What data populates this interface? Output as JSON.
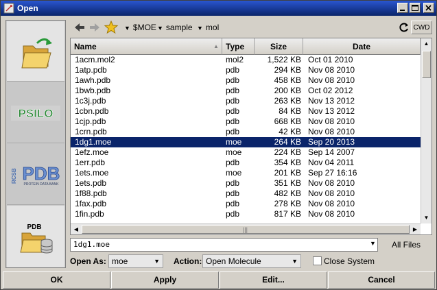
{
  "window": {
    "title": "Open"
  },
  "sidebar": {
    "items": [
      {
        "name": "open-folder"
      },
      {
        "name": "psilo",
        "label": "PSILO"
      },
      {
        "name": "rcsb-pdb",
        "label": "PDB",
        "sublabel": "PROTEIN DATA BANK",
        "prefix": "RCSB"
      },
      {
        "name": "pdb-folder",
        "label": "PDB"
      }
    ]
  },
  "toolbar": {
    "path": [
      "$MOE",
      "sample",
      "mol"
    ],
    "cwd_label": "CWD"
  },
  "table": {
    "columns": [
      "Name",
      "Type",
      "Size",
      "Date"
    ],
    "rows": [
      {
        "name": "1acm.mol2",
        "type": "mol2",
        "size": "1,522 KB",
        "date": " Oct 01 2010"
      },
      {
        "name": "1atp.pdb",
        "type": "pdb",
        "size": "294 KB",
        "date": "Nov 08 2010"
      },
      {
        "name": "1awh.pdb",
        "type": "pdb",
        "size": "458 KB",
        "date": "Nov 08 2010"
      },
      {
        "name": "1bwb.pdb",
        "type": "pdb",
        "size": "200 KB",
        "date": " Oct 02 2012"
      },
      {
        "name": "1c3j.pdb",
        "type": "pdb",
        "size": "263 KB",
        "date": "Nov 13 2012"
      },
      {
        "name": "1cbn.pdb",
        "type": "pdb",
        "size": "84 KB",
        "date": "Nov 13 2012"
      },
      {
        "name": "1cjp.pdb",
        "type": "pdb",
        "size": "668 KB",
        "date": "Nov 08 2010"
      },
      {
        "name": "1crn.pdb",
        "type": "pdb",
        "size": "42 KB",
        "date": "Nov 08 2010"
      },
      {
        "name": "1dg1.moe",
        "type": "moe",
        "size": "264 KB",
        "date": "Sep 20 2013",
        "selected": true
      },
      {
        "name": "1efz.moe",
        "type": "moe",
        "size": "224 KB",
        "date": "Sep 14 2007"
      },
      {
        "name": "1err.pdb",
        "type": "pdb",
        "size": "354 KB",
        "date": "Nov 04 2011"
      },
      {
        "name": "1ets.moe",
        "type": "moe",
        "size": "201 KB",
        "date": "Sep 27 16:16"
      },
      {
        "name": "1ets.pdb",
        "type": "pdb",
        "size": "351 KB",
        "date": "Nov 08 2010"
      },
      {
        "name": "1f88.pdb",
        "type": "pdb",
        "size": "482 KB",
        "date": "Nov 08 2010"
      },
      {
        "name": "1fax.pdb",
        "type": "pdb",
        "size": "278 KB",
        "date": "Nov 08 2010"
      },
      {
        "name": "1fin.pdb",
        "type": "pdb",
        "size": "817 KB",
        "date": "Nov 08 2010"
      }
    ]
  },
  "filename": {
    "value": "1dg1.moe",
    "filter_label": "All Files"
  },
  "options": {
    "open_as_label": "Open As:",
    "open_as_value": "moe",
    "action_label": "Action:",
    "action_value": "Open Molecule",
    "close_system_label": "Close System",
    "close_system_checked": false
  },
  "buttons": {
    "ok": "OK",
    "apply": "Apply",
    "edit": "Edit...",
    "cancel": "Cancel"
  },
  "colors": {
    "selection": "#0a246a",
    "titlebar": "#0a246a",
    "psilo_green": "#2e8b3a",
    "pdb_blue": "#4a6fb0"
  }
}
